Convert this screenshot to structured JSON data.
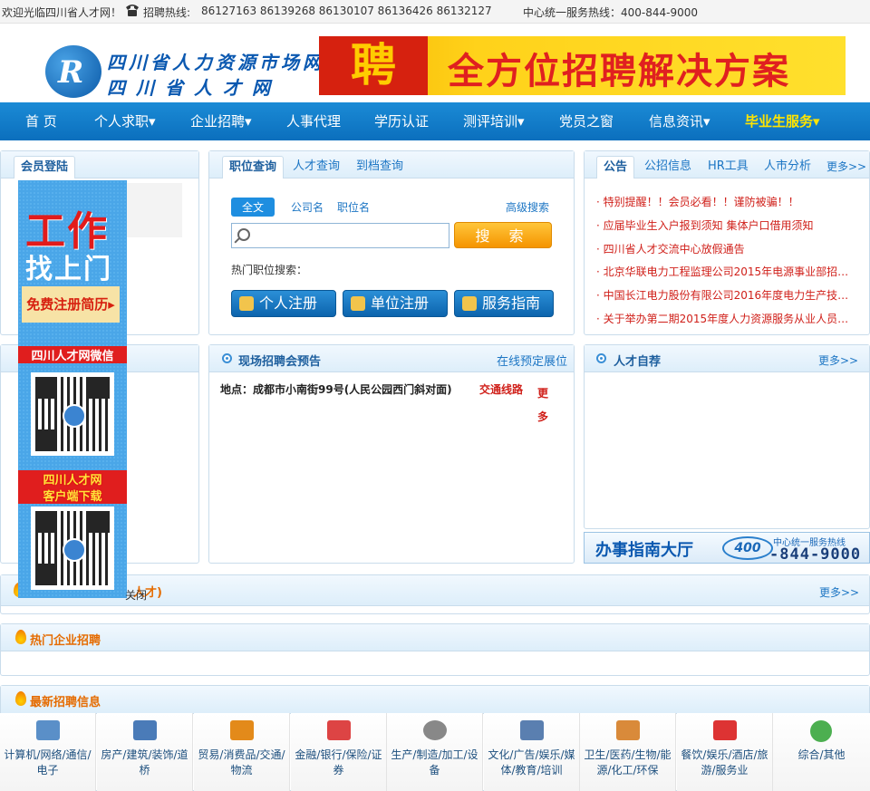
{
  "topbar": {
    "welcome": "欢迎光临四川省人才网！",
    "hotline_label": "招聘热线:",
    "hotline_numbers": "86127163 86139268 86130107 86136426 86132127",
    "center_hotline": "中心统一服务热线：400-844-9000"
  },
  "header": {
    "logo_mark": "R",
    "logo_line1": "四川省人力资源市场网",
    "logo_line2": "四川省人才网",
    "banner_badge": "聘",
    "banner_text": "全方位招聘解决方案"
  },
  "nav": [
    {
      "label": "首 页"
    },
    {
      "label": "个人求职▾"
    },
    {
      "label": "企业招聘▾"
    },
    {
      "label": "人事代理"
    },
    {
      "label": "学历认证"
    },
    {
      "label": "测评培训▾"
    },
    {
      "label": "党员之窗"
    },
    {
      "label": "信息资讯▾"
    },
    {
      "label": "毕业生服务▾"
    }
  ],
  "login": {
    "tab": "会员登陆"
  },
  "search": {
    "tabs": [
      "职位查询",
      "人才查询",
      "到档查询"
    ],
    "subtabs": [
      "全文",
      "公司名",
      "职位名"
    ],
    "advanced": "高级搜索",
    "button": "搜 索",
    "hot_label": "热门职位搜索：",
    "buttons": [
      "个人注册",
      "单位注册",
      "服务指南"
    ]
  },
  "notices": {
    "tabs": [
      "公告",
      "公招信息",
      "HR工具",
      "人市分析"
    ],
    "more": "更多>>",
    "items": [
      "特别提醒！！会员必看！！谨防被骗！！",
      "应届毕业生入户报到须知   集体户口借用须知",
      "四川省人才交流中心放假通告",
      "北京华联电力工程监理公司2015年电源事业部招…",
      "中国长江电力股份有限公司2016年度电力生产技…",
      "关于举办第二期2015年度人力资源服务从业人员…"
    ]
  },
  "fair": {
    "title": "现场招聘会预告",
    "link": "在线预定展位",
    "address_label": "地点：成都市小南街99号(人民公园西门斜对面)",
    "route": "交通线路",
    "more": "更多"
  },
  "talent": {
    "title": "人才自荐",
    "more": "更多>>"
  },
  "guide": {
    "title": "办事指南大厅",
    "logo": "400",
    "sub": "中心统一服务热线",
    "number": "-844-9000"
  },
  "premium": {
    "title": "人才)",
    "more": "更多>>"
  },
  "hot_companies": {
    "title": "热门企业招聘"
  },
  "latest": {
    "title": "最新招聘信息"
  },
  "float_ad": {
    "work": "工作",
    "door": "找上门",
    "register": "免费注册简历▸",
    "wechat": "四川人才网微信",
    "download1": "四川人才网",
    "download2": "客户端下载",
    "close": "关闭"
  },
  "categories": [
    {
      "label": "计算机/网络/通信/电子",
      "color": "#5a8fc8"
    },
    {
      "label": "房产/建筑/装饰/道桥",
      "color": "#4a7bb8"
    },
    {
      "label": "贸易/消费品/交通/物流",
      "color": "#e38a1a"
    },
    {
      "label": "金融/银行/保险/证券",
      "color": "#d44"
    },
    {
      "label": "生产/制造/加工/设备",
      "color": "#888"
    },
    {
      "label": "文化/广告/娱乐/媒体/教育/培训",
      "color": "#5a7fb0"
    },
    {
      "label": "卫生/医药/生物/能源/化工/环保",
      "color": "#d98a3a"
    },
    {
      "label": "餐饮/娱乐/酒店/旅游/服务业",
      "color": "#d33"
    },
    {
      "label": "综合/其他",
      "color": "#4caf50"
    }
  ]
}
